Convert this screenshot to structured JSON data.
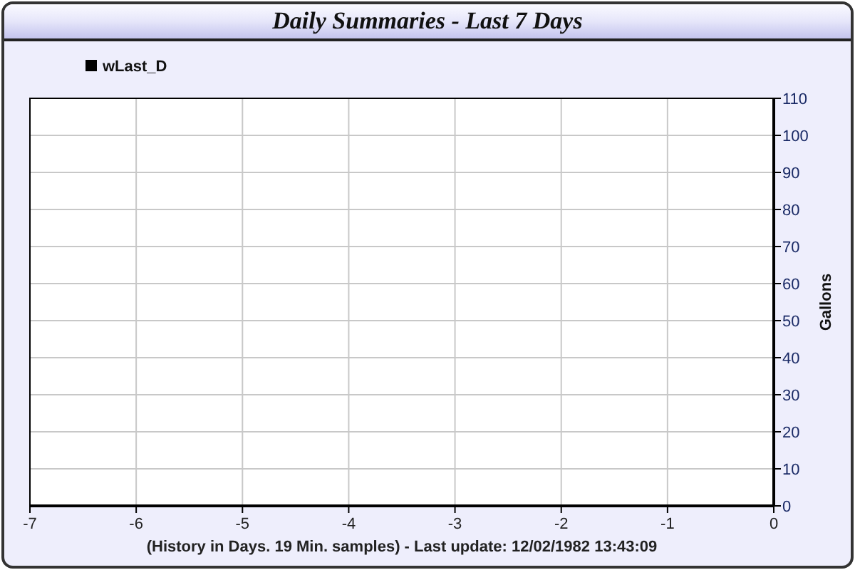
{
  "window": {
    "title": "Daily Summaries - Last 7 Days"
  },
  "chart_data": {
    "type": "line",
    "xlabel": "(History in Days. 19 Min. samples) - Last update: 12/02/1982 13:43:09",
    "ylabel": "Gallons",
    "grid": true,
    "x": [
      -7,
      -6,
      -5,
      -4,
      -3,
      -2,
      -1,
      0
    ],
    "series": [
      {
        "name": "wLast_D",
        "color": "#000000",
        "values": [
          0,
          0,
          0,
          0,
          0,
          0,
          0,
          0
        ]
      }
    ],
    "xlim": [
      -7,
      0
    ],
    "ylim": [
      0,
      110
    ],
    "xticks": [
      -7,
      -6,
      -5,
      -4,
      -3,
      -2,
      -1,
      0
    ],
    "yticks": [
      0,
      10,
      20,
      30,
      40,
      50,
      60,
      70,
      80,
      90,
      100,
      110
    ]
  }
}
